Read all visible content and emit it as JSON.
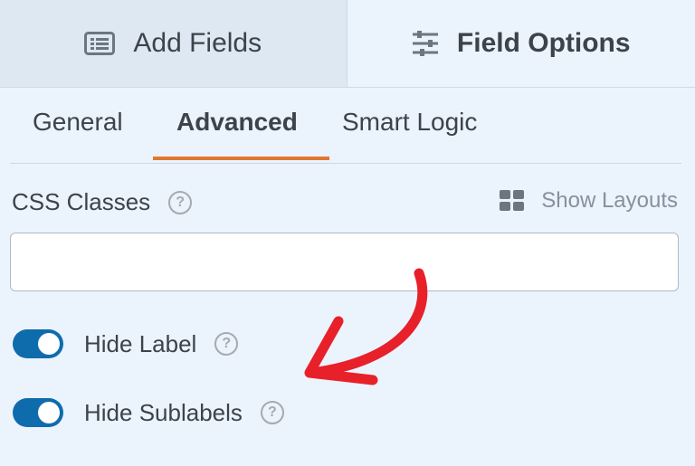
{
  "top_tabs": {
    "add_fields": "Add Fields",
    "field_options": "Field Options"
  },
  "sub_tabs": [
    {
      "label": "General"
    },
    {
      "label": "Advanced",
      "active": true
    },
    {
      "label": "Smart Logic"
    }
  ],
  "css_classes": {
    "label": "CSS Classes",
    "value": "",
    "placeholder": ""
  },
  "show_layouts": {
    "label": "Show Layouts",
    "icon": "grid-icon"
  },
  "toggles": [
    {
      "label": "Hide Label",
      "on": true
    },
    {
      "label": "Hide Sublabels",
      "on": true
    }
  ],
  "colors": {
    "accent_underline": "#e27730",
    "toggle_on": "#0e6cad",
    "annotation_arrow": "#e8202a",
    "panel_bg": "#ebf3fc"
  }
}
